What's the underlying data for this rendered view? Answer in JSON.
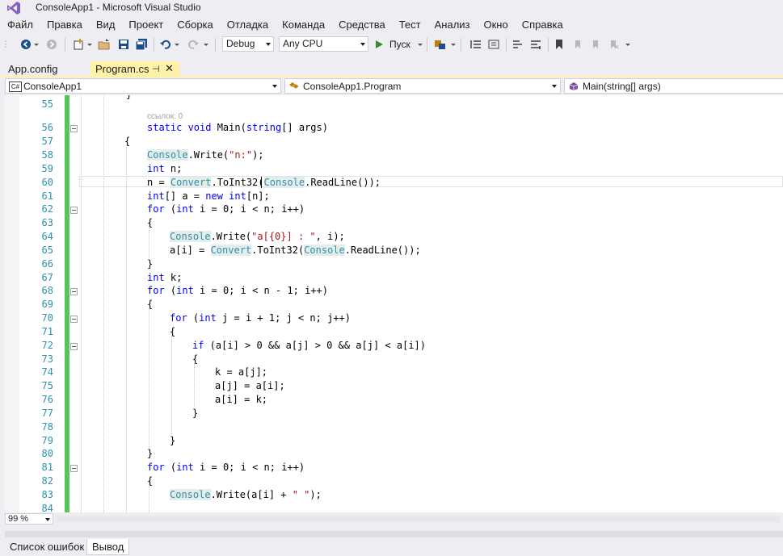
{
  "window": {
    "title": "ConsoleApp1 - Microsoft Visual Studio"
  },
  "menu": [
    "Файл",
    "Правка",
    "Вид",
    "Проект",
    "Сборка",
    "Отладка",
    "Команда",
    "Средства",
    "Тест",
    "Анализ",
    "Окно",
    "Справка"
  ],
  "toolbar": {
    "config": "Debug",
    "platform": "Any CPU",
    "start_label": "Пуск"
  },
  "tabs": [
    {
      "label": "App.config",
      "active": false
    },
    {
      "label": "Program.cs",
      "active": true
    }
  ],
  "navbar": {
    "project": "ConsoleApp1",
    "type": "ConsoleApp1.Program",
    "member": "Main(string[] args)"
  },
  "editor": {
    "references_hint": "ссылок: 0",
    "line_numbers": [
      "55",
      "56",
      "57",
      "58",
      "59",
      "60",
      "61",
      "62",
      "63",
      "64",
      "65",
      "66",
      "67",
      "68",
      "69",
      "70",
      "71",
      "72",
      "73",
      "74",
      "75",
      "76",
      "77",
      "78",
      "79",
      "80",
      "81",
      "82",
      "83",
      "84"
    ],
    "lines": {
      "l56": [
        "static ",
        "void ",
        "Main(",
        "string",
        "[] args)"
      ],
      "l57": "{",
      "l58": [
        "Console",
        ".Write(",
        "\"n:\"",
        ");"
      ],
      "l59": [
        "int",
        " n;"
      ],
      "l60": [
        "n = ",
        "Convert",
        ".ToInt32(",
        "Console",
        ".ReadLine());"
      ],
      "l61": [
        "int",
        "[] a = ",
        "new ",
        "int",
        "[n];"
      ],
      "l62": [
        "for",
        " (",
        "int",
        " i = 0; i < n; i++)"
      ],
      "l63": "{",
      "l64": [
        "Console",
        ".Write(",
        "\"a[{0}] : \"",
        ", i);"
      ],
      "l65": [
        "a[i] = ",
        "Convert",
        ".ToInt32(",
        "Console",
        ".ReadLine());"
      ],
      "l66": "}",
      "l67": [
        "int",
        " k;"
      ],
      "l68": [
        "for",
        " (",
        "int",
        " i = 0; i < n - 1; i++)"
      ],
      "l69": "{",
      "l70": [
        "for",
        " (",
        "int",
        " j = i + 1; j < n; j++)"
      ],
      "l71": "{",
      "l72": [
        "if",
        " (a[i] > 0 && a[j] > 0 && a[j] < a[i])"
      ],
      "l73": "{",
      "l74": "k = a[j];",
      "l75": "a[j] = a[i];",
      "l76": "a[i] = k;",
      "l77": "}",
      "l79": "}",
      "l80": "}",
      "l81": [
        "for",
        " (",
        "int",
        " i = 0; i < n; i++)"
      ],
      "l82": "{",
      "l83": [
        "Console",
        ".Write(a[i] + ",
        "\" \"",
        ");"
      ]
    }
  },
  "status": {
    "zoom": "99 %"
  },
  "bottom_tabs": [
    "Список ошибок",
    "Вывод"
  ],
  "colors": {
    "keyword": "#0000ff",
    "type": "#2b91af",
    "string": "#a31515",
    "active_tab": "#fff1a8",
    "change_bar": "#57c65a"
  }
}
